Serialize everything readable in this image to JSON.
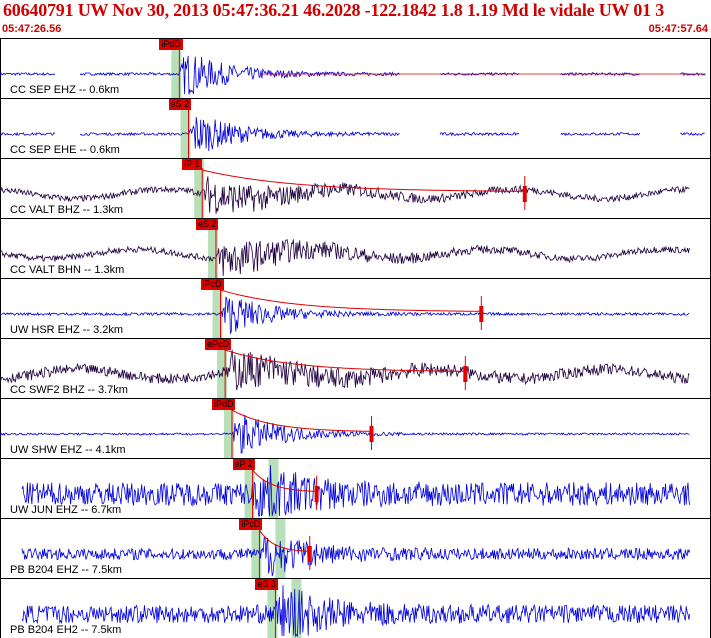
{
  "header": {
    "title": "60640791 UW Nov 30, 2013 05:47:36.21   46.2028 -122.1842  1.8 1.19 Md le vidale UW 01   3",
    "start_time": "05:47:26.56",
    "end_time": "05:47:57.64"
  },
  "time_window": {
    "start_s": 26.56,
    "end_s": 57.64
  },
  "colors": {
    "title": "#d00000",
    "trace_blue": "#0000dd",
    "trace_dark": "#200040",
    "pick": "#e00000",
    "window": "#b8e0b8",
    "frame": "#000000"
  },
  "channels": [
    {
      "label": "CC SEP EHZ -- 0.6km",
      "pick": "iPdD",
      "color": "blue",
      "style": "gappy",
      "pick_t": 34.4,
      "coda_t": null,
      "noise": 0.05,
      "peak": 1.0
    },
    {
      "label": "CC SEP EHE -- 0.6km",
      "pick": "eS 2",
      "color": "blue",
      "style": "gappy",
      "pick_t": 34.8,
      "coda_t": null,
      "noise": 0.05,
      "peak": 0.95
    },
    {
      "label": "CC VALT BHZ -- 1.3km",
      "pick": "iP 1",
      "color": "dark",
      "style": "swell",
      "pick_t": 35.4,
      "coda_t": 49.5,
      "noise": 0.12,
      "peak": 0.7
    },
    {
      "label": "CC VALT BHN -- 1.3km",
      "pick": "eS 2",
      "color": "dark",
      "style": "swell",
      "pick_t": 36.0,
      "coda_t": null,
      "noise": 0.12,
      "peak": 0.75
    },
    {
      "label": "UW HSR EHZ -- 3.2km",
      "pick": "iPcD",
      "color": "blue",
      "style": "quiet",
      "pick_t": 36.2,
      "coda_t": 47.6,
      "noise": 0.05,
      "peak": 0.9
    },
    {
      "label": "CC SWF2 BHZ -- 3.7km",
      "pick": "ePcD",
      "color": "dark",
      "style": "swell",
      "pick_t": 36.4,
      "coda_t": 46.9,
      "noise": 0.2,
      "peak": 0.7
    },
    {
      "label": "UW SHW EHZ -- 4.1km",
      "pick": "iPdD",
      "color": "blue",
      "style": "quiet",
      "pick_t": 36.7,
      "coda_t": 42.8,
      "noise": 0.04,
      "peak": 0.95
    },
    {
      "label": "UW JUN EHZ -- 6.7km",
      "pick": "eP 2",
      "color": "blue",
      "style": "noisy",
      "pick_t": 37.6,
      "coda_t": 40.4,
      "noise": 0.45,
      "peak": 1.0
    },
    {
      "label": "PB B204 EHZ -- 7.5km",
      "pick": "iPcD",
      "color": "blue",
      "style": "noisy",
      "pick_t": 37.9,
      "coda_t": 40.1,
      "noise": 0.22,
      "peak": 0.85
    },
    {
      "label": "PB B204 EH2 -- 7.5km",
      "pick": "eS 3",
      "color": "blue",
      "style": "noisy",
      "pick_t": 38.6,
      "coda_t": null,
      "noise": 0.35,
      "peak": 1.0
    }
  ]
}
